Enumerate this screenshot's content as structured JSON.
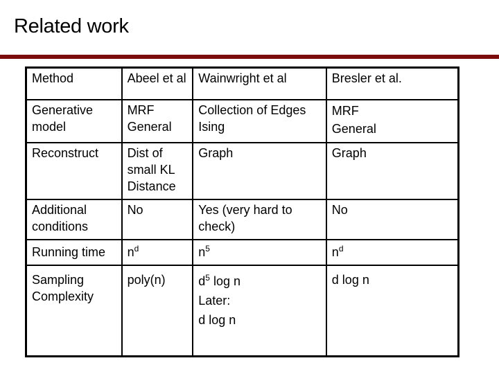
{
  "slide": {
    "title": "Related work",
    "accent_color": "#7a0c0c"
  },
  "table": {
    "columns": [
      "Method",
      "Abeel et al",
      "Wainwright et al",
      "Bresler et al."
    ],
    "rows": [
      {
        "label": "Generative model",
        "abbeel": "MRF General",
        "wainwright": "Collection of Edges Ising",
        "bresler": [
          "MRF",
          "General"
        ]
      },
      {
        "label": "Reconstruct",
        "abbeel": "Dist of small KL Distance",
        "wainwright": "Graph",
        "bresler": "Graph"
      },
      {
        "label": "Additional conditions",
        "abbeel": "No",
        "wainwright": "Yes (very hard to check)",
        "bresler": "No"
      },
      {
        "label": "Running time",
        "abbeel": {
          "base": "n",
          "exp": "d"
        },
        "wainwright": {
          "base": "n",
          "exp": "5"
        },
        "bresler": {
          "base": "n",
          "exp": "d"
        }
      },
      {
        "label": "Sampling Complexity",
        "abbeel": "poly(n)",
        "wainwright": {
          "base": "d",
          "exp": "5",
          "rest": " log n",
          "line2": "Later:",
          "line3": "d log n"
        },
        "bresler": "d log n"
      }
    ]
  }
}
